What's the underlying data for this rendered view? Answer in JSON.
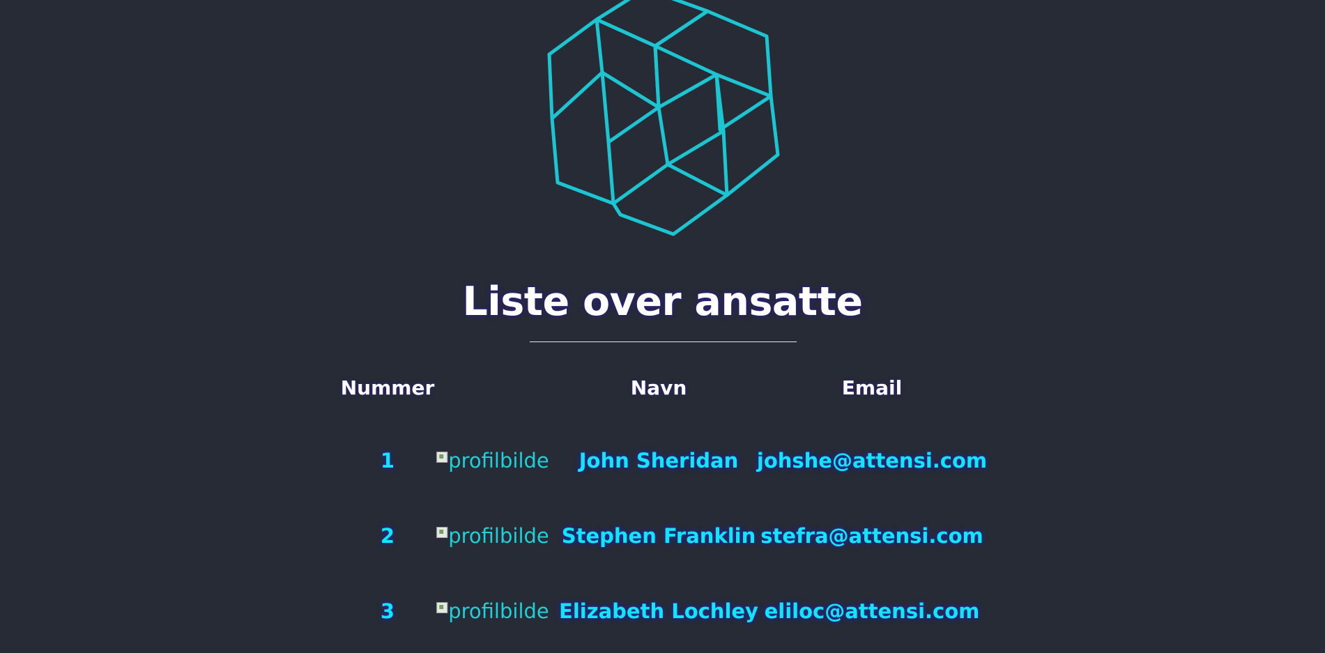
{
  "page": {
    "title": "Liste over ansatte"
  },
  "logo": {
    "icon": "hexagonal-cube-logo-icon",
    "color": "#1cc5d2"
  },
  "table": {
    "headers": {
      "number": "Nummer",
      "name": "Navn",
      "email": "Email"
    },
    "rows": [
      {
        "number": "1",
        "image_alt": "profilbilde",
        "name": "John Sheridan",
        "email": "johshe@attensi.com"
      },
      {
        "number": "2",
        "image_alt": "profilbilde",
        "name": "Stephen Franklin",
        "email": "stefra@attensi.com"
      },
      {
        "number": "3",
        "image_alt": "profilbilde",
        "name": "Elizabeth Lochley",
        "email": "eliloc@attensi.com"
      }
    ]
  },
  "colors": {
    "background": "#272b35",
    "accent": "#13e6f2",
    "heading": "#ffffff"
  }
}
